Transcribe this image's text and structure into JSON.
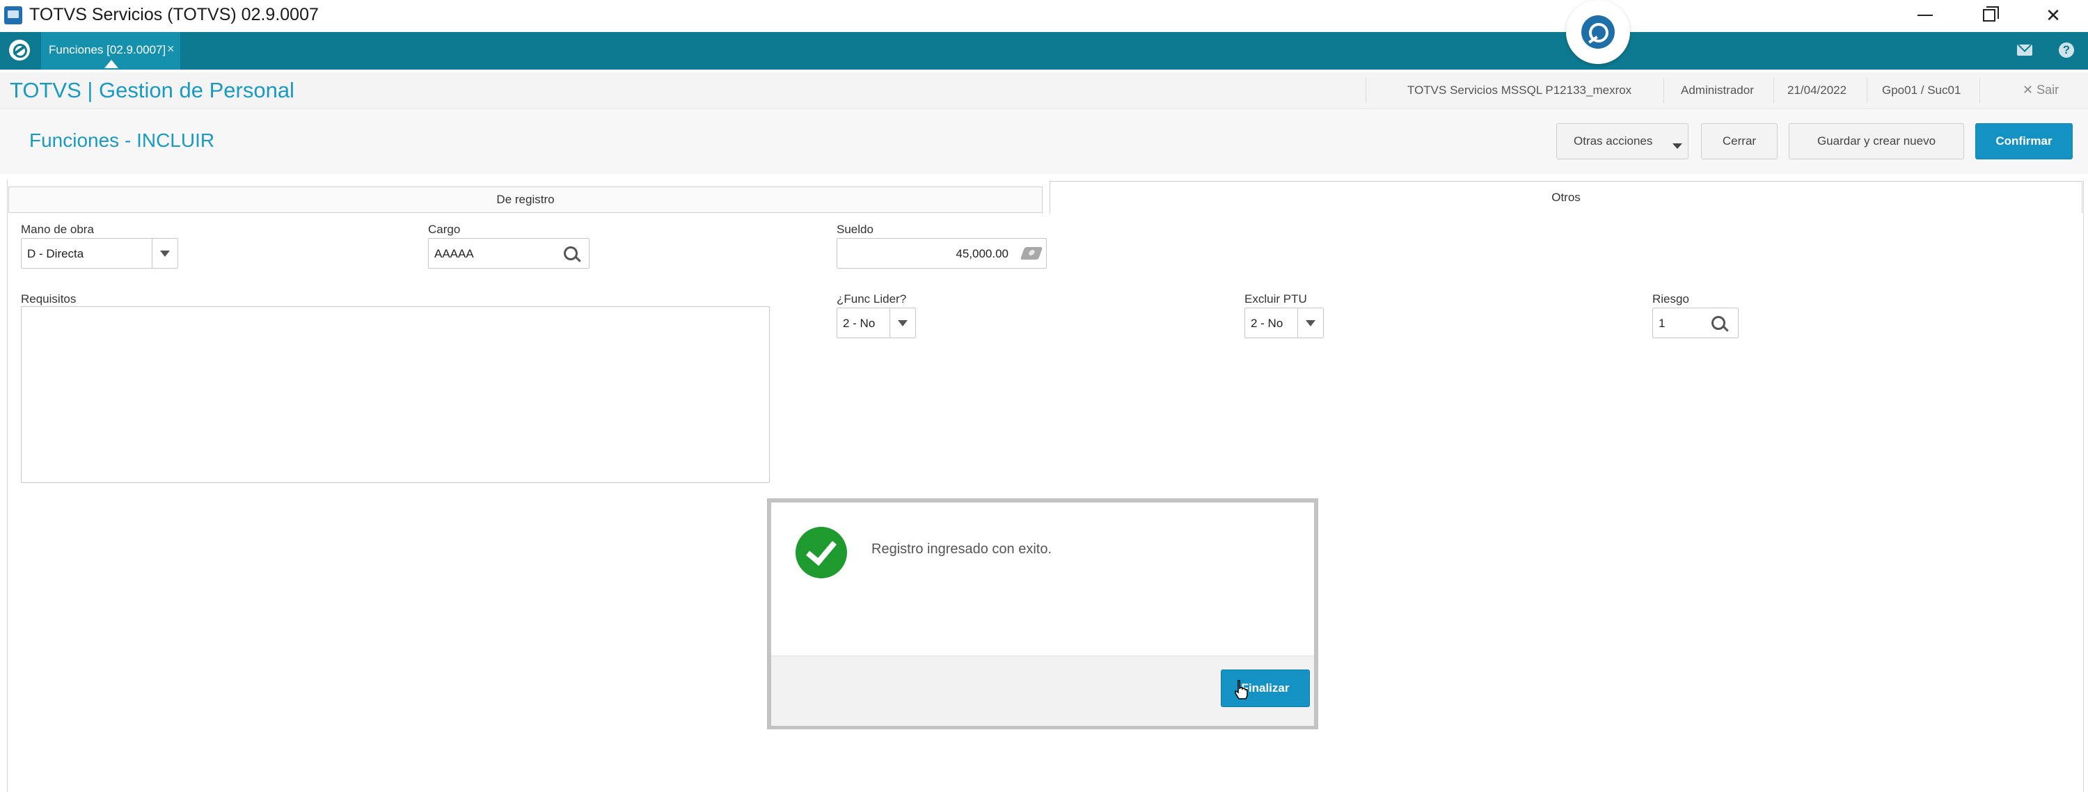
{
  "os_window": {
    "title": "TOTVS Servicios (TOTVS) 02.9.0007",
    "minimize_glyph": "",
    "maximize_glyph": "",
    "close_glyph": "✕"
  },
  "tabbar": {
    "tab_label": "Funciones [02.9.0007]",
    "tab_close": "×",
    "help_glyph": "?"
  },
  "module": {
    "title": "TOTVS | Gestion de Personal",
    "environment": "TOTVS Servicios MSSQL P12133_mexrox",
    "user": "Administrador",
    "date": "21/04/2022",
    "branch": "Gpo01 / Suc01",
    "exit_label": "✕  Sair"
  },
  "page": {
    "title": "Funciones - INCLUIR",
    "actions": {
      "other_actions": "Otras acciones",
      "close": "Cerrar",
      "save_new": "Guardar y crear nuevo",
      "confirm": "Confirmar"
    }
  },
  "tabs": [
    {
      "label": "De registro",
      "active": false
    },
    {
      "label": "Otros",
      "active": true
    }
  ],
  "form": {
    "mano_de_obra": {
      "label": "Mano de obra",
      "value": "D - Directa"
    },
    "cargo": {
      "label": "Cargo",
      "value": "AAAAA"
    },
    "sueldo": {
      "label": "Sueldo",
      "value": "45,000.00"
    },
    "requisitos": {
      "label": "Requisitos",
      "value": ""
    },
    "func_lider": {
      "label": "¿Func Lider?",
      "value": "2 - No"
    },
    "excluir_ptu": {
      "label": "Excluir PTU",
      "value": "2 - No"
    },
    "riesgo": {
      "label": "Riesgo",
      "value": "1"
    }
  },
  "modal": {
    "message": "Registro ingresado con exito.",
    "button": "Finalizar"
  },
  "colors": {
    "accent": "#1592c4",
    "tabbar": "#0d7a92",
    "success": "#1f9a2e"
  }
}
